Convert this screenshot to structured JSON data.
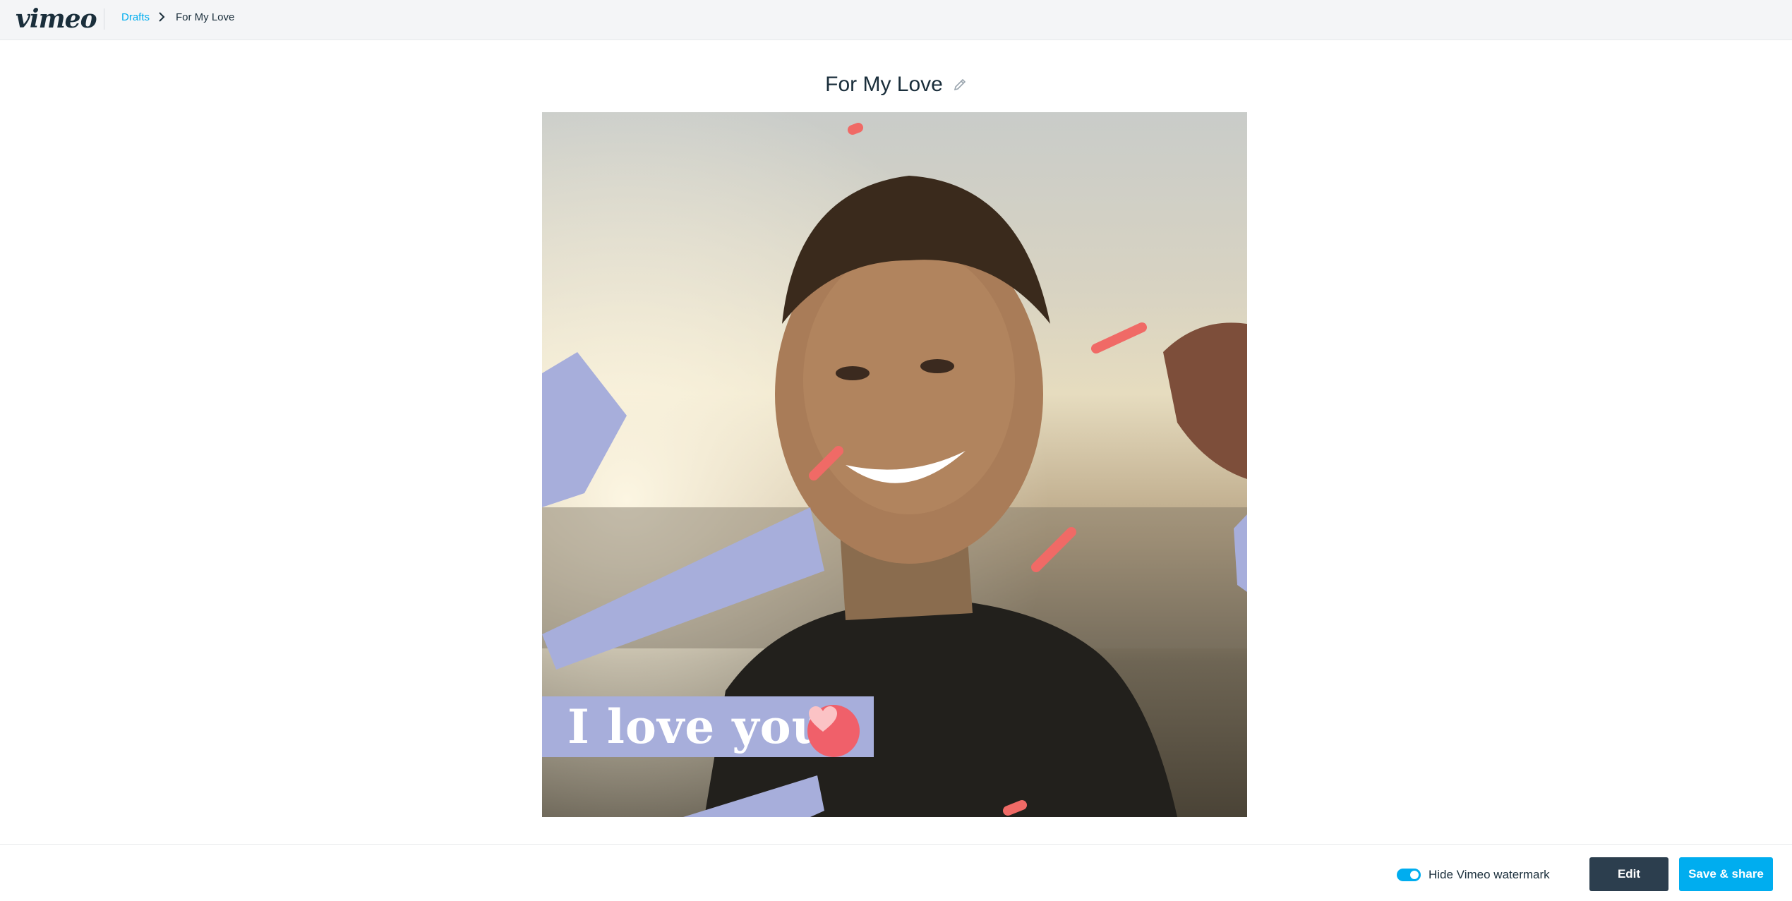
{
  "header": {
    "logo_text": "vimeo",
    "breadcrumb": {
      "parent_label": "Drafts",
      "current_label": "For My Love"
    }
  },
  "main": {
    "title": "For My Love",
    "video": {
      "overlay_text": "I love you",
      "overlay_color": "#a7aedb",
      "heart_color": "#f0606a"
    }
  },
  "footer": {
    "watermark_toggle": {
      "label": "Hide Vimeo watermark",
      "checked": true
    },
    "edit_label": "Edit",
    "save_label": "Save & share"
  },
  "colors": {
    "accent": "#00adef",
    "dark_button": "#2c3e4e",
    "text": "#1a2e3b"
  },
  "icons": {
    "breadcrumb_separator": "chevron-right-icon",
    "title_edit": "pencil-icon"
  }
}
